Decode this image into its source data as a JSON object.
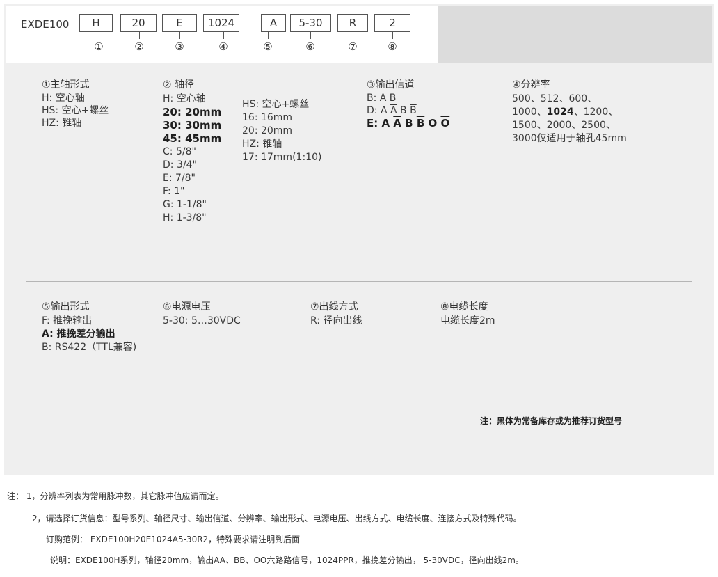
{
  "code": {
    "prefix": "EXDE100",
    "boxes": [
      "H",
      "20",
      "E",
      "1024",
      "A",
      "5-30",
      "R",
      "2"
    ],
    "numbers": [
      "①",
      "②",
      "③",
      "④",
      "⑤",
      "⑥",
      "⑦",
      "⑧"
    ]
  },
  "shaft_type": {
    "title": "①主轴形式",
    "items": [
      "H: 空心轴",
      "HS: 空心+螺丝",
      "HZ: 锥轴"
    ]
  },
  "shaft_dia": {
    "title": "② 轴径",
    "left_items": [
      "H: 空心轴",
      "20: 20mm",
      "30: 30mm",
      "45: 45mm",
      "C: 5/8\"",
      "D: 3/4\"",
      "E: 7/8\"",
      "F: 1\"",
      "G: 1-1/8\"",
      "H: 1-3/8\""
    ],
    "right_items": [
      "HS: 空心+螺丝",
      "16: 16mm",
      "20: 20mm",
      "HZ: 锥轴",
      "17: 17mm(1:10)"
    ]
  },
  "output_channel": {
    "title": "③输出信道",
    "b_prefix": "B: ",
    "b_value": "A B",
    "d_prefix": "D: ",
    "d_a": "A ",
    "d_abar": "A",
    "d_b": " B ",
    "d_bbar": "B",
    "e_prefix": "E: ",
    "e_a": "A ",
    "e_abar": "A",
    "e_b": " B ",
    "e_bbar": "B",
    "e_o": " O ",
    "e_obar": "O"
  },
  "resolution": {
    "title": "④分辨率",
    "line1": "500、512、600、",
    "line2_pre": "1000、",
    "line2_bold": "1024",
    "line2_post": "、1200、",
    "line3": "1500、2000、2500、",
    "line4": "3000仅适用于轴孔45mm"
  },
  "output_form": {
    "title": "⑤输出形式",
    "items": [
      "F: 推挽输出",
      "A: 推挽差分输出",
      "B: RS422（TTL兼容)"
    ]
  },
  "voltage": {
    "title": "⑥电源电压",
    "items": [
      "5-30:  5…30VDC"
    ]
  },
  "outlet": {
    "title": "⑦出线方式",
    "items": [
      "R: 径向出线"
    ]
  },
  "cable": {
    "title": "⑧电缆长度",
    "items": [
      "电缆长度2m"
    ]
  },
  "panel_note": "注：黑体为常备库存或为推荐订货型号",
  "footnotes": {
    "note1": "注：  1，分辨率列表为常用脉冲数，其它脉冲值应请而定。",
    "note2": "2，请选择订货信息：型号系列、轴径尺寸、输出信道、分辨率、输出形式、电源电压、出线方式、电缆长度、连接方式及特殊代码。",
    "example": "订购范例： EXDE100H20E1024A5-30R2，特殊要求请注明到后面",
    "exp_pre": "说明：EXDE100H系列，轴径20mm，输出A",
    "exp_abar": "A",
    "exp_mid1": "、B",
    "exp_bbar": "B",
    "exp_mid2": "、O",
    "exp_obar": "O",
    "exp_post": "六路路信号，1024PPR，推挽差分输出， 5-30VDC，径向出线2m。"
  }
}
